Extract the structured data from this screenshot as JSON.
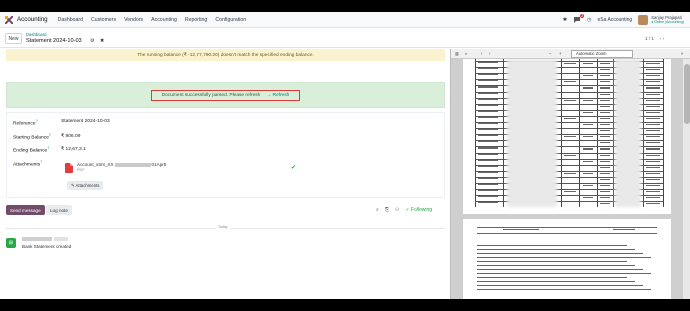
{
  "navbar": {
    "app_name": "Accounting",
    "menus": [
      "Dashboard",
      "Customers",
      "Vendors",
      "Accounting",
      "Reporting",
      "Configuration"
    ],
    "chat_badge": "2",
    "company": "eSa Accounting",
    "user_name": "Sanjay Prajapati",
    "user_sub": "● Online (Accounting)"
  },
  "control": {
    "new_label": "New",
    "breadcrumb_parent": "Dashboard",
    "breadcrumb_current": "Statement 2024-10-03",
    "pager": "1 / 1"
  },
  "alerts": {
    "warning": "The running balance (₹ -12,77,790.20) doesn't match the specified ending balance.",
    "success": "Document successfully parsed. Please refresh",
    "refresh_label": "→ Refresh"
  },
  "form": {
    "reference_label": "Reference",
    "reference_value": "Statement 2024-10-03",
    "starting_label": "Starting Balance",
    "starting_value": "₹ 906.09",
    "ending_label": "Ending Balance",
    "ending_value": "₹ 12,67,2.1",
    "attachments_label": "Attachments",
    "attachment_name_start": "Account_stmt_XX",
    "attachment_name_end": "01Apr5",
    "attachment_type": "PDF",
    "attachments_button": "✎ Attachments"
  },
  "chatter": {
    "send_label": "Send message",
    "log_label": "Log note",
    "following_label": "✓ Following",
    "today_label": "Today",
    "message": "Bank Statement created"
  },
  "viewer": {
    "zoom_label": "Automatic Zoom"
  }
}
